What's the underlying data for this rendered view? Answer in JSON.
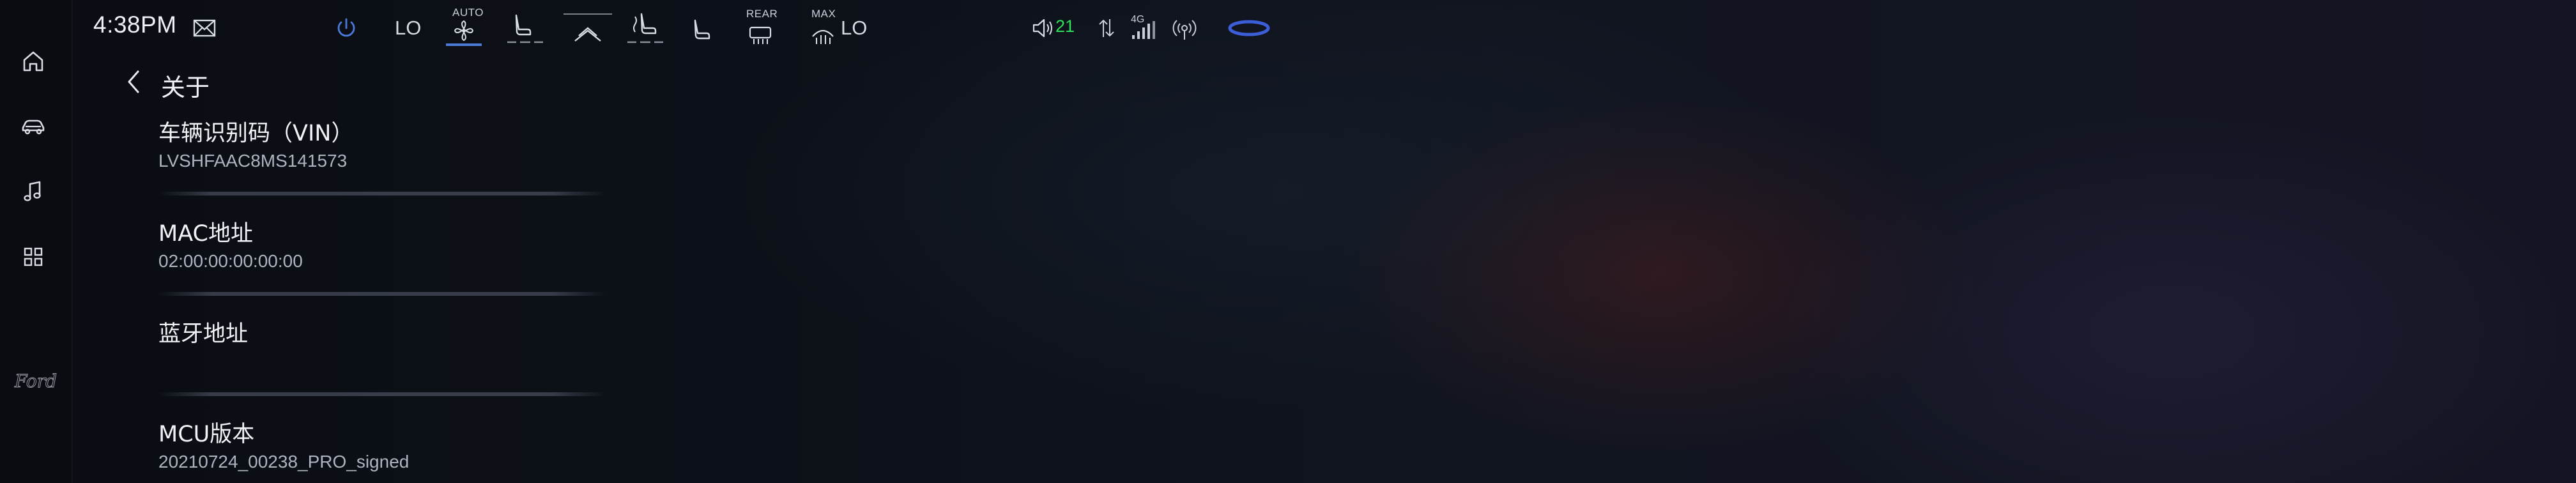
{
  "status_bar": {
    "time": "4:38PM",
    "climate": {
      "left_temp": "LO",
      "right_temp": "LO",
      "auto_label": "AUTO",
      "rear_label": "REAR",
      "max_label": "MAX",
      "active_color": "#4a7bd8"
    },
    "cabin_temp": "21",
    "network_label": "4G",
    "temp_color": "#2fe05c"
  },
  "nav_rail": {
    "icons": [
      "home-icon",
      "car-icon",
      "music-icon",
      "apps-icon"
    ],
    "brand": "Ford"
  },
  "page": {
    "title": "关于"
  },
  "about_items": [
    {
      "label": "车辆识别码（VIN）",
      "value": "LVSHFAAC8MS141573"
    },
    {
      "label": "MAC地址",
      "value": "02:00:00:00:00:00"
    },
    {
      "label": "蓝牙地址",
      "value": ""
    },
    {
      "label": "MCU版本",
      "value": "20210724_00238_PRO_signed"
    }
  ]
}
